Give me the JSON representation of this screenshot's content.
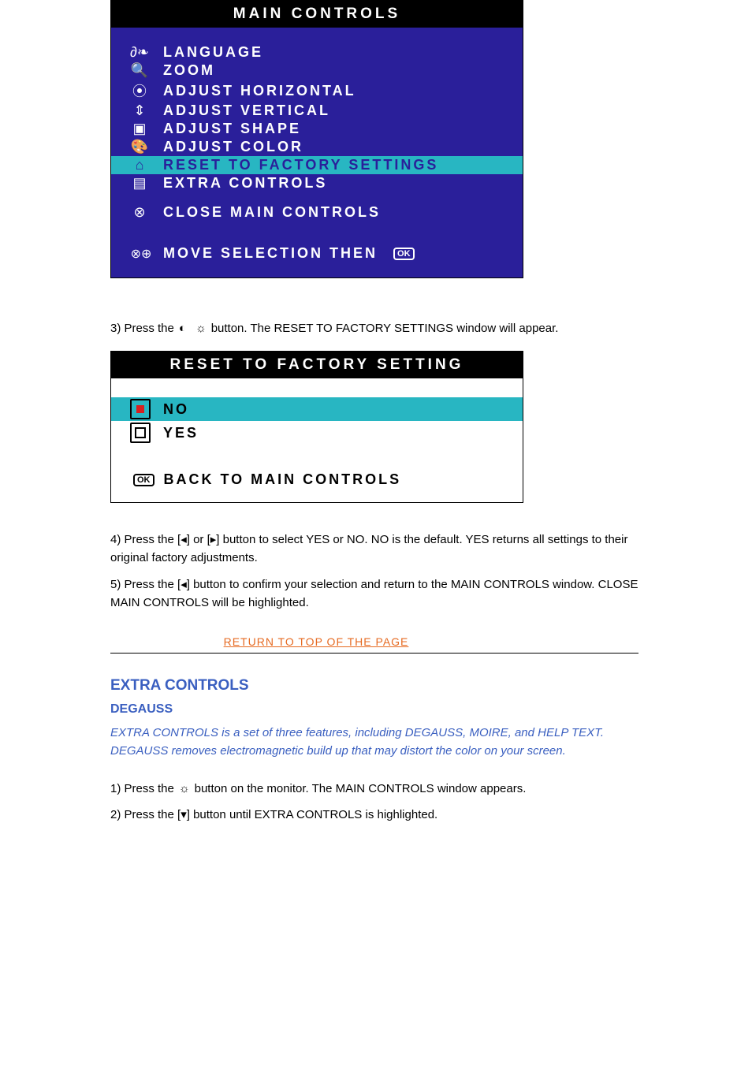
{
  "main_controls": {
    "title": "MAIN CONTROLS",
    "items": [
      {
        "icon": "language-icon",
        "glyph": "∂❧",
        "label": "LANGUAGE"
      },
      {
        "icon": "zoom-icon",
        "glyph": "🔍",
        "label": "ZOOM"
      },
      {
        "icon": "adjust-horizontal-icon",
        "glyph": "⦿",
        "label": "ADJUST HORIZONTAL"
      },
      {
        "icon": "adjust-vertical-icon",
        "glyph": "⇕",
        "label": "ADJUST VERTICAL"
      },
      {
        "icon": "adjust-shape-icon",
        "glyph": "▣",
        "label": "ADJUST SHAPE"
      },
      {
        "icon": "adjust-color-icon",
        "glyph": "🎨",
        "label": "ADJUST COLOR"
      },
      {
        "icon": "reset-factory-icon",
        "glyph": "⌂",
        "label": "RESET TO FACTORY SETTINGS",
        "highlight": true
      },
      {
        "icon": "extra-controls-icon",
        "glyph": "▤",
        "label": "EXTRA CONTROLS"
      }
    ],
    "close_label": "CLOSE MAIN CONTROLS",
    "close_glyph": "⊗",
    "footer_label": "MOVE SELECTION THEN",
    "footer_ok": "OK"
  },
  "step3": {
    "prefix": "3) Press the ",
    "suffix": " button. The RESET TO FACTORY SETTINGS window will appear."
  },
  "reset_panel": {
    "title": "RESET TO FACTORY SETTING",
    "no_label": "NO",
    "yes_label": "YES",
    "footer_ok": "OK",
    "footer_label": "BACK TO MAIN CONTROLS"
  },
  "para4": "4) Press the  [◂]  or  [▸]  button to select YES or NO. NO is the default. YES returns all settings to their original factory adjustments.",
  "para5": "5) Press the  [◂]  button to confirm your selection and return to the MAIN CONTROLS window. CLOSE MAIN CONTROLS will be highlighted.",
  "return_link": "RETURN TO TOP OF THE PAGE",
  "extra_section": {
    "heading": "EXTRA CONTROLS",
    "subheading": "DEGAUSS",
    "intro": "EXTRA CONTROLS is a set of three features, including DEGAUSS, MOIRE, and HELP TEXT. DEGAUSS removes electromagnetic build up that may distort the color on your screen.",
    "step1_prefix": "1) Press the ",
    "step1_suffix": " button on the monitor. The MAIN CONTROLS window appears.",
    "step2": "2) Press the  [▾]  button until EXTRA CONTROLS is highlighted."
  }
}
